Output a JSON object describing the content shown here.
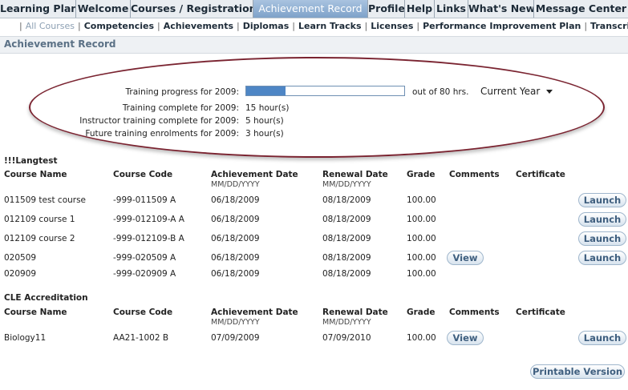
{
  "nav": {
    "tabs": [
      "Learning Plan",
      "Welcome",
      "Courses / Registration",
      "Achievement Record",
      "Profile",
      "Help",
      "Links",
      "What's New",
      "Message Center"
    ],
    "active_index": 3
  },
  "subnav": [
    "All Courses",
    "Competencies",
    "Achievements",
    "Diplomas",
    "Learn Tracks",
    "Licenses",
    "Performance Improvement Plan",
    "Transcript"
  ],
  "page_title": "Achievement Record",
  "progress": {
    "label_progress": "Training progress for 2009:",
    "value": "20",
    "fraction": 0.25,
    "out_of": "out of 80 hrs.",
    "year_select": "Current Year",
    "label_complete": "Training complete for 2009:",
    "value_complete": "15 hour(s)",
    "label_instructor": "Instructor training complete for 2009:",
    "value_instructor": "5 hour(s)",
    "label_future": "Future training enrolments for 2009:",
    "value_future": "3 hour(s)"
  },
  "columns": {
    "name": "Course Name",
    "code": "Course Code",
    "achievement": "Achievement Date",
    "date_format": "MM/DD/YYYY",
    "renewal": "Renewal Date",
    "grade": "Grade",
    "comments": "Comments",
    "certificate": "Certificate"
  },
  "groups": [
    {
      "title": "!!!Langtest",
      "rows": [
        {
          "name": "011509 test course",
          "code": "-999-011509 A",
          "achieved": "06/18/2009",
          "renewal": "08/18/2009",
          "grade": "100.00"
        },
        {
          "name": "012109 course 1",
          "code": "-999-012109-A A",
          "achieved": "06/18/2009",
          "renewal": "08/18/2009",
          "grade": "100.00"
        },
        {
          "name": "012109 course 2",
          "code": "-999-012109-B A",
          "achieved": "06/18/2009",
          "renewal": "08/18/2009",
          "grade": "100.00"
        },
        {
          "name": "020509",
          "code": "-999-020509 A",
          "achieved": "06/18/2009",
          "renewal": "08/18/2009",
          "grade": "100.00"
        },
        {
          "name": "020909",
          "code": "-999-020909 A",
          "achieved": "06/18/2009",
          "renewal": "08/18/2009",
          "grade": "100.00"
        }
      ]
    },
    {
      "title": "CLE Accreditation",
      "rows": [
        {
          "name": "Biology11",
          "code": "AA21-1002 B",
          "achieved": "07/09/2009",
          "renewal": "07/09/2010",
          "grade": "100.00"
        }
      ]
    }
  ],
  "buttons": {
    "launch": "Launch",
    "view": "View",
    "printable": "Printable Version"
  }
}
